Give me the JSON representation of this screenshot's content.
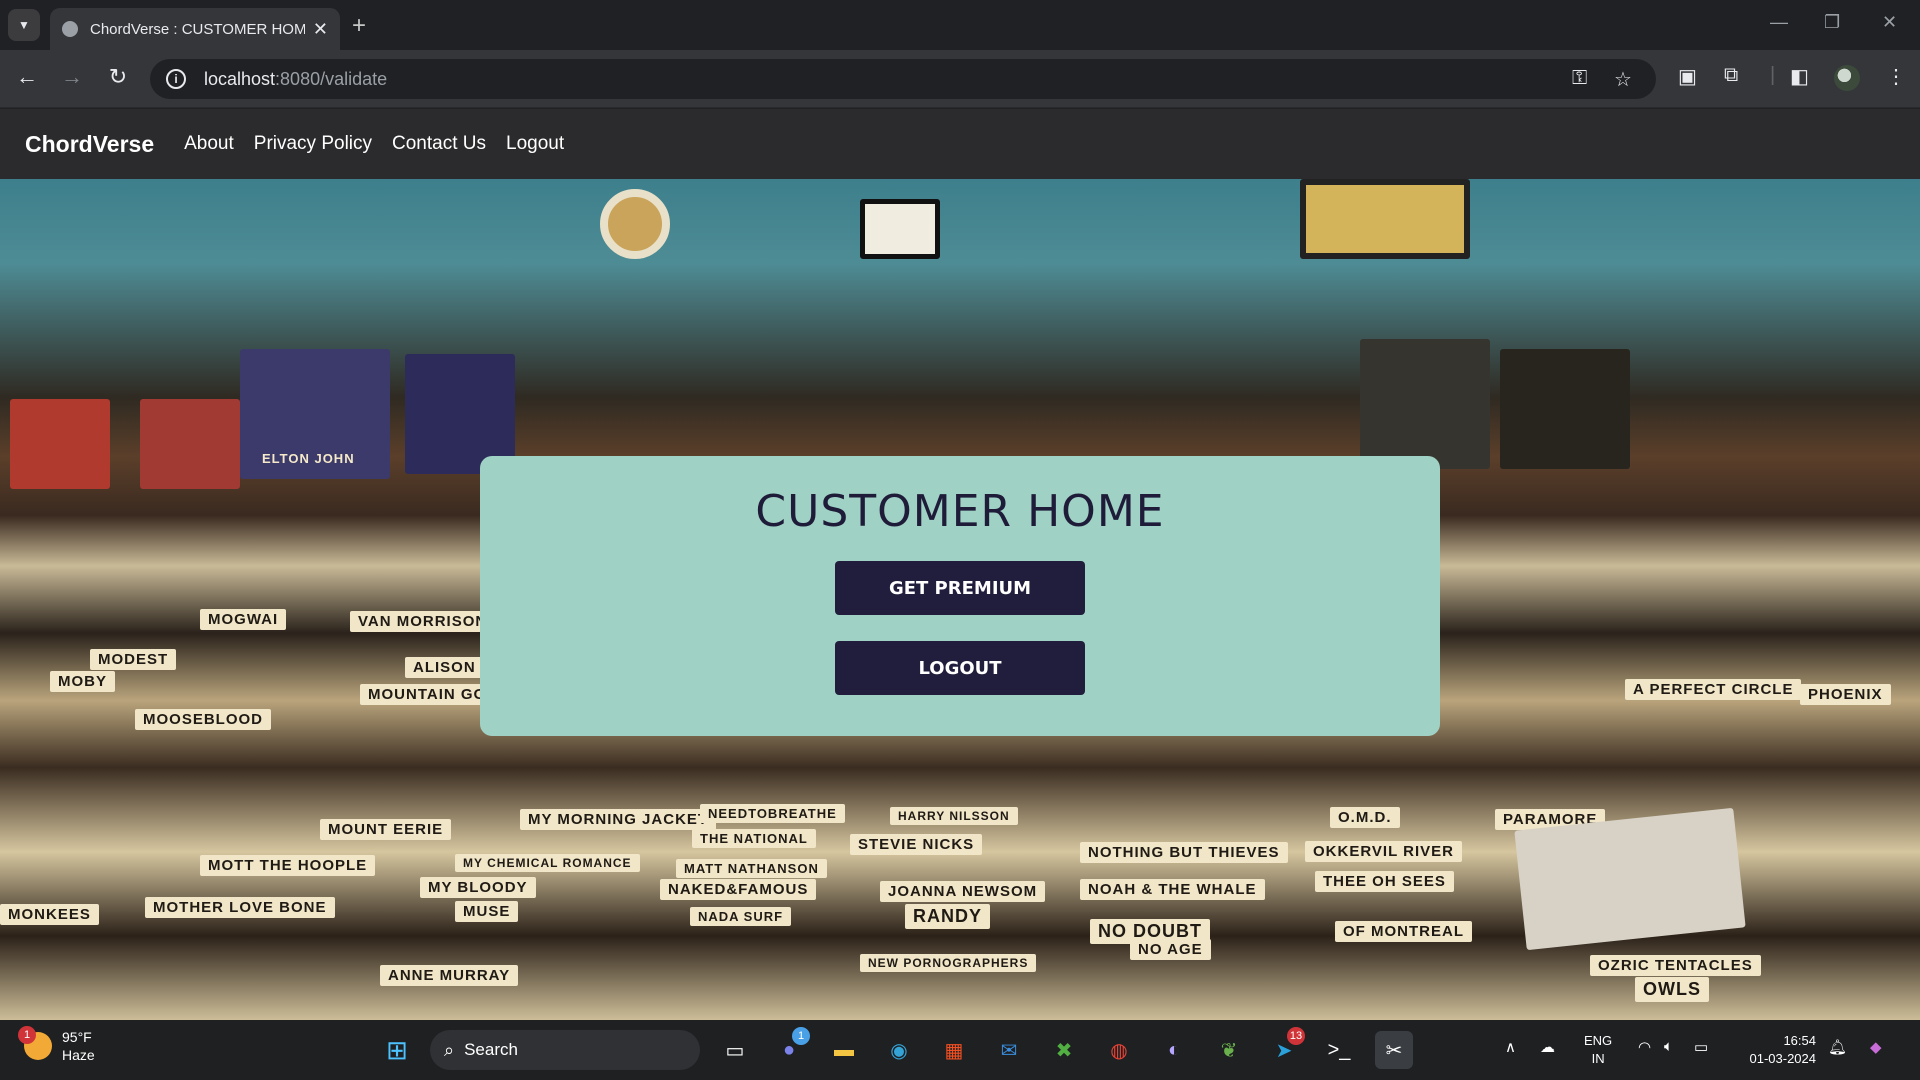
{
  "browser": {
    "tab_title": "ChordVerse : CUSTOMER HOME",
    "url_host": "localhost",
    "url_path": ":8080/validate"
  },
  "site": {
    "brand": "ChordVerse",
    "nav": [
      "About",
      "Privacy Policy",
      "Contact Us",
      "Logout"
    ]
  },
  "card": {
    "title": "CUSTOMER HOME",
    "premium_label": "GET PREMIUM",
    "logout_label": "LOGOUT",
    "background": "#9fd1c4",
    "button_color": "#211d3d"
  },
  "background_signs": [
    "MOGWAI",
    "VAN MORRISON",
    "MODEST",
    "MOBY",
    "ALISON MO",
    "MOUNTAIN GOATS",
    "MOOSEBLOOD",
    "MY MORNING JACKET",
    "MOUNT EERIE",
    "MOTT THE HOOPLE",
    "MY CHEMICAL ROMANCE",
    "MY BLOODY",
    "MUSE",
    "MOTHER LOVE BONE",
    "ANNE MURRAY",
    "NEEDTOBREATHE",
    "THE NATIONAL",
    "MATT NATHANSON",
    "NAKED&FAMOUS",
    "NADA SURF",
    "HARRY NILSSON",
    "STEVIE NICKS",
    "JOANNA NEWSOM",
    "RANDY",
    "NEW PORNOGRAPHERS",
    "NOTHING BUT THIEVES",
    "NOAH & THE WHALE",
    "NO DOUBT",
    "NO AGE",
    "O.M.D.",
    "OKKERVIL RIVER",
    "THEE OH SEES",
    "OF MONTREAL",
    "PARAMORE",
    "A PERFECT CIRCLE",
    "PHOENIX",
    "OZRIC TENTACLES",
    "OWLS",
    "ELTON JOHN",
    "MONKEES"
  ],
  "taskbar": {
    "weather_temp": "95°F",
    "weather_desc": "Haze",
    "weather_badge": "1",
    "search_label": "Search",
    "chat_badge": "1",
    "telegram_badge": "13",
    "lang_top": "ENG",
    "lang_bottom": "IN",
    "time": "16:54",
    "date": "01-03-2024"
  }
}
